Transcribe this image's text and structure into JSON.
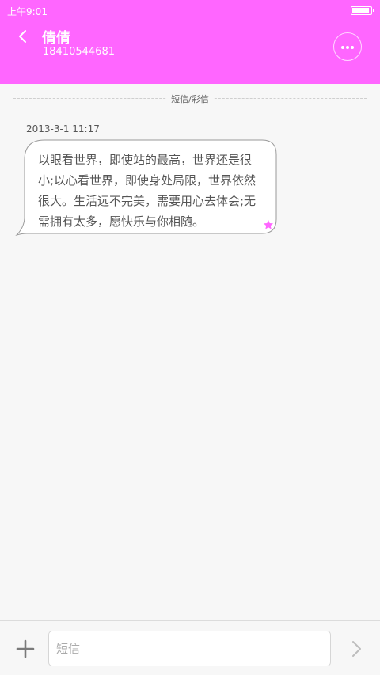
{
  "status_bar": {
    "time": "上午9:01",
    "battery_icon": "battery-icon",
    "battery_level": 0.9
  },
  "header": {
    "contact_name": "倩倩",
    "phone_number": "18410544681",
    "back_icon": "chevron-left-icon",
    "more_icon": "more-dots-icon",
    "background_color": "#ff66ff"
  },
  "conversation": {
    "section_label": "短信/彩信",
    "messages": [
      {
        "timestamp": "2013-3-1 11:17",
        "text": "以眼看世界，即使站的最高，世界还是很小;以心看世界，即使身处局限，世界依然很大。生活远不完美，需要用心去体会;无需拥有太多，愿快乐与你相随。",
        "starred": true,
        "star_color": "#ff66ff"
      }
    ]
  },
  "composer": {
    "add_icon": "plus-icon",
    "input_placeholder": "短信",
    "input_value": "",
    "send_icon": "chevron-right-icon"
  }
}
